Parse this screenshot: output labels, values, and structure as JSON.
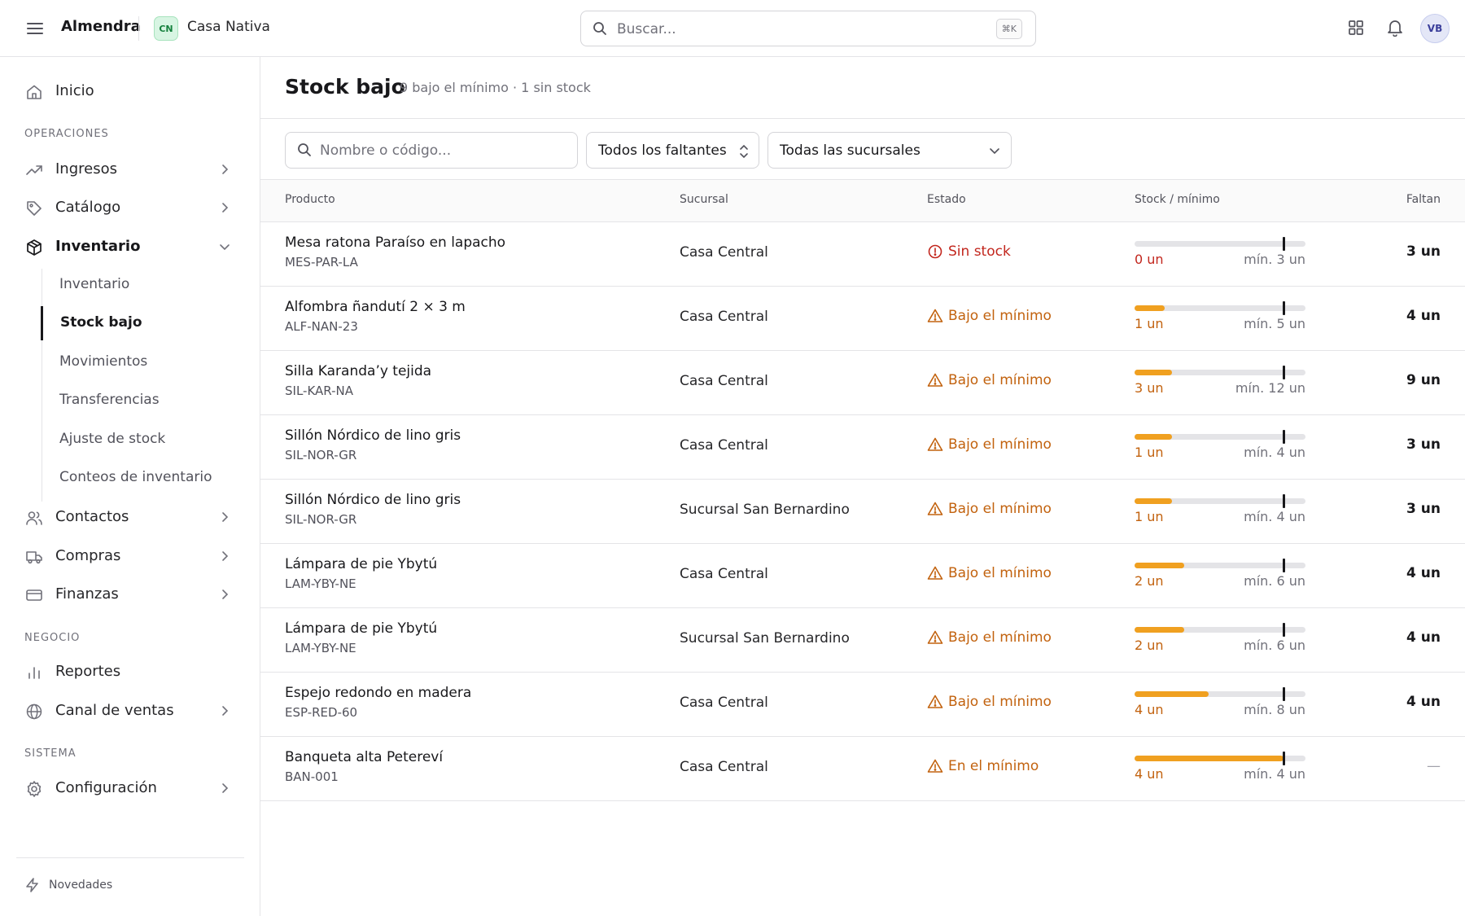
{
  "topbar": {
    "brand": "Almendra",
    "workspace_initials": "CN",
    "workspace_name": "Casa Nativa",
    "search_placeholder": "Buscar...",
    "search_shortcut": "⌘K",
    "avatar_initials": "VB"
  },
  "sidebar": {
    "inicio": "Inicio",
    "section_operaciones": "OPERACIONES",
    "ingresos": "Ingresos",
    "catalogo": "Catálogo",
    "inventario": "Inventario",
    "inventario_sub": [
      "Inventario",
      "Stock bajo",
      "Movimientos",
      "Transferencias",
      "Ajuste de stock",
      "Conteos de inventario"
    ],
    "contactos": "Contactos",
    "compras": "Compras",
    "finanzas": "Finanzas",
    "section_negocio": "NEGOCIO",
    "reportes": "Reportes",
    "canal_ventas": "Canal de ventas",
    "section_sistema": "SISTEMA",
    "configuracion": "Configuración",
    "novedades": "Novedades"
  },
  "page": {
    "title": "Stock bajo",
    "subtitle": "9 bajo el mínimo · 1 sin stock",
    "filter_search_placeholder": "Nombre o código...",
    "filter_faltantes": "Todos los faltantes",
    "filter_sucursales": "Todas las sucursales"
  },
  "table": {
    "headers": {
      "producto": "Producto",
      "sucursal": "Sucursal",
      "estado": "Estado",
      "stock": "Stock / mínimo",
      "faltan": "Faltan"
    },
    "rows": [
      {
        "name": "Mesa ratona Paraíso en lapacho",
        "code": "MES-PAR-LA",
        "sucursal": "Casa Central",
        "estado": "Sin stock",
        "estado_tipo": "red",
        "stock": 0,
        "minimo": 3,
        "stock_label": "0 un",
        "minimo_label": "mín. 3 un",
        "faltan": "3 un"
      },
      {
        "name": "Alfombra ñandutí 2 × 3 m",
        "code": "ALF-NAN-23",
        "sucursal": "Casa Central",
        "estado": "Bajo el mínimo",
        "estado_tipo": "amber",
        "stock": 1,
        "minimo": 5,
        "stock_label": "1 un",
        "minimo_label": "mín. 5 un",
        "faltan": "4 un"
      },
      {
        "name": "Silla Karanda’y tejida",
        "code": "SIL-KAR-NA",
        "sucursal": "Casa Central",
        "estado": "Bajo el mínimo",
        "estado_tipo": "amber",
        "stock": 3,
        "minimo": 12,
        "stock_label": "3 un",
        "minimo_label": "mín. 12 un",
        "faltan": "9 un"
      },
      {
        "name": "Sillón Nórdico de lino gris",
        "code": "SIL-NOR-GR",
        "sucursal": "Casa Central",
        "estado": "Bajo el mínimo",
        "estado_tipo": "amber",
        "stock": 1,
        "minimo": 4,
        "stock_label": "1 un",
        "minimo_label": "mín. 4 un",
        "faltan": "3 un"
      },
      {
        "name": "Sillón Nórdico de lino gris",
        "code": "SIL-NOR-GR",
        "sucursal": "Sucursal San Bernardino",
        "estado": "Bajo el mínimo",
        "estado_tipo": "amber",
        "stock": 1,
        "minimo": 4,
        "stock_label": "1 un",
        "minimo_label": "mín. 4 un",
        "faltan": "3 un"
      },
      {
        "name": "Lámpara de pie Ybytú",
        "code": "LAM-YBY-NE",
        "sucursal": "Casa Central",
        "estado": "Bajo el mínimo",
        "estado_tipo": "amber",
        "stock": 2,
        "minimo": 6,
        "stock_label": "2 un",
        "minimo_label": "mín. 6 un",
        "faltan": "4 un"
      },
      {
        "name": "Lámpara de pie Ybytú",
        "code": "LAM-YBY-NE",
        "sucursal": "Sucursal San Bernardino",
        "estado": "Bajo el mínimo",
        "estado_tipo": "amber",
        "stock": 2,
        "minimo": 6,
        "stock_label": "2 un",
        "minimo_label": "mín. 6 un",
        "faltan": "4 un"
      },
      {
        "name": "Espejo redondo en madera",
        "code": "ESP-RED-60",
        "sucursal": "Casa Central",
        "estado": "Bajo el mínimo",
        "estado_tipo": "amber",
        "stock": 4,
        "minimo": 8,
        "stock_label": "4 un",
        "minimo_label": "mín. 8 un",
        "faltan": "4 un"
      },
      {
        "name": "Banqueta alta Petereví",
        "code": "BAN-001",
        "sucursal": "Casa Central",
        "estado": "En el mínimo",
        "estado_tipo": "amber",
        "stock": 4,
        "minimo": 4,
        "stock_label": "4 un",
        "minimo_label": "mín. 4 un",
        "faltan": "—"
      }
    ]
  }
}
